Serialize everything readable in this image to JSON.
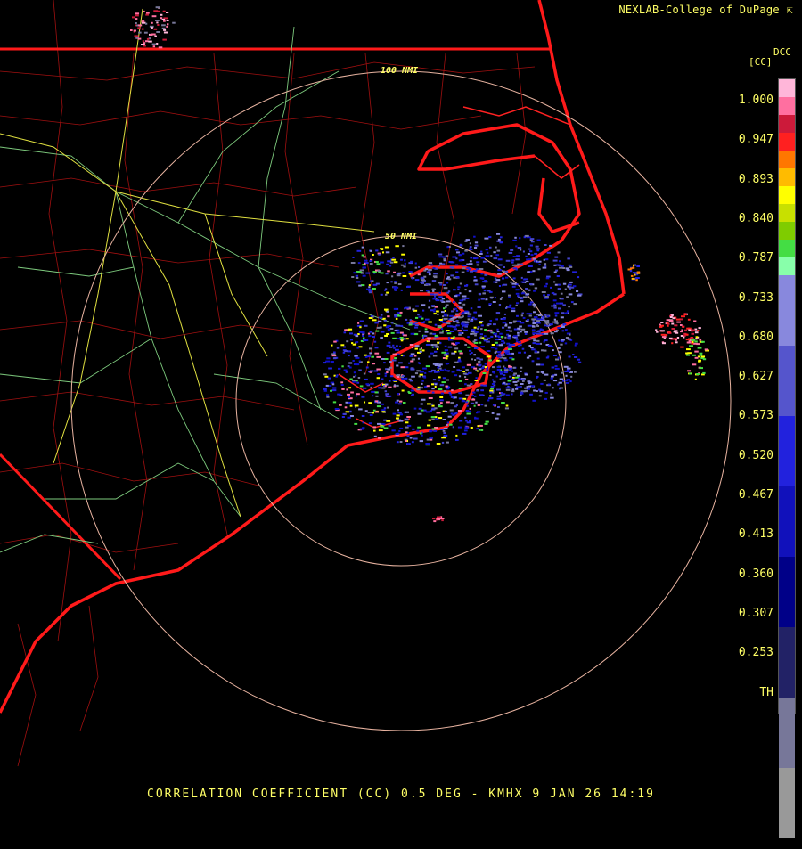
{
  "credit": "NEXLAB-College of DuPage",
  "credit_icon": "cursor-icon",
  "footer": "CORRELATION COEFFICIENT (CC) 0.5 DEG - KMHX 9 JAN 26 14:19",
  "legend": {
    "title_top": "DCC",
    "title_unit": "[CC]",
    "labels": [
      "1.000",
      "0.947",
      "0.893",
      "0.840",
      "0.787",
      "0.733",
      "0.680",
      "0.627",
      "0.573",
      "0.520",
      "0.467",
      "0.413",
      "0.360",
      "0.307",
      "0.253",
      "TH"
    ],
    "colors": [
      "#ffb6d9",
      "#ff6fa0",
      "#cc1a3a",
      "#ff2020",
      "#ff7700",
      "#ffbb00",
      "#ffff00",
      "#c8e000",
      "#7fcc00",
      "#44dd44",
      "#88ffaa",
      "#8888dd",
      "#5555cc",
      "#2222dd",
      "#1111bb",
      "#000088",
      "#222266",
      "#777799",
      "#999999",
      "#000000"
    ]
  },
  "range_rings": [
    {
      "label": "50 NMI"
    },
    {
      "label": "100 NMI"
    }
  ]
}
